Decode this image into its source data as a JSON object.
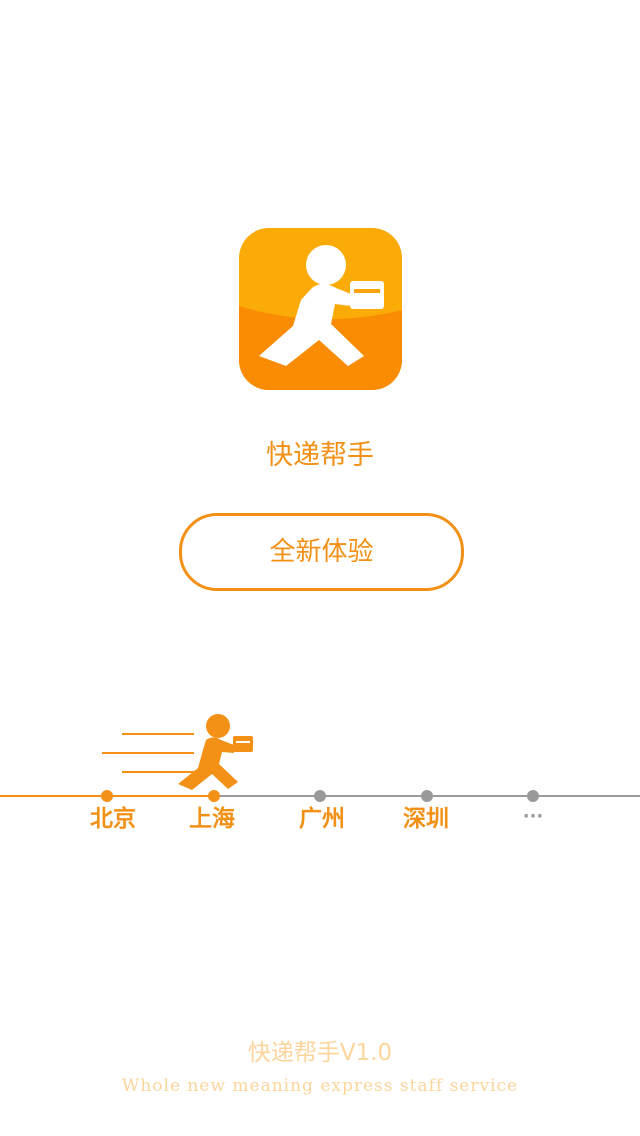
{
  "app": {
    "name": "快递帮手",
    "icon": "courier-runner-icon"
  },
  "actions": {
    "experience_label": "全新体验"
  },
  "route": {
    "stops": [
      {
        "label": "北京",
        "status": "done"
      },
      {
        "label": "上海",
        "status": "current"
      },
      {
        "label": "广州",
        "status": "todo"
      },
      {
        "label": "深圳",
        "status": "todo"
      },
      {
        "label": "···",
        "status": "todo"
      }
    ]
  },
  "footer": {
    "title": "快递帮手V1.0",
    "subtitle": "Whole new meaning express staff service"
  },
  "colors": {
    "accent": "#f39016",
    "accent_light": "#fbd59c",
    "inactive": "#9a9a9a"
  }
}
